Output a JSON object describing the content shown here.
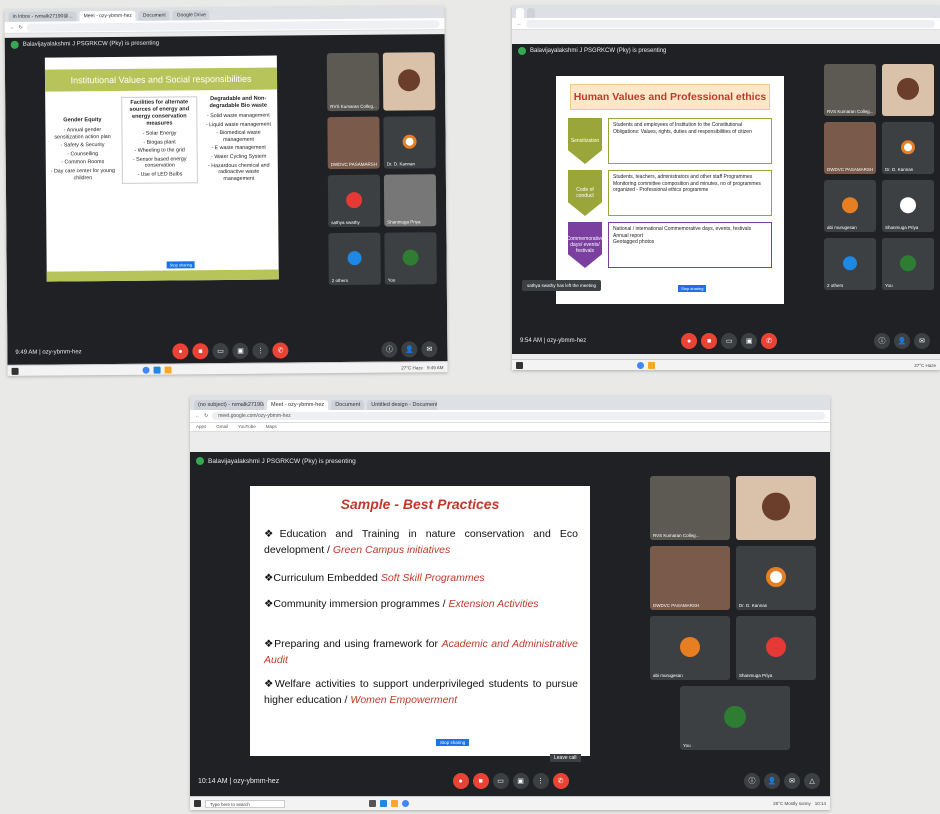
{
  "shot1": {
    "tabs": [
      "In Inbox - rvmalk27190@...",
      "Meet - ozy-ybmm-hez",
      "Document",
      "Google Drive"
    ],
    "presenter": "Balavijayalakshmi J PSGRKCW (Pky) is presenting",
    "slide": {
      "title": "Institutional Values and Social responsibilities",
      "col1_head": "Gender Equity",
      "col1": [
        "- Annual gender sensitization action plan",
        "- Safety & Security",
        "- Counselling",
        "- Common Rooms",
        "- Day care center for young children"
      ],
      "col2_head": "Facilities for alternate sources of energy and energy conservation measures",
      "col2": [
        "- Solar Energy",
        "- Biogas plant",
        "- Wheeling to the grid",
        "- Sensor based energy conservation",
        "- Use of LED Bulbs"
      ],
      "col3_head": "Degradable and Non-degradable Bio waste",
      "col3": [
        "- Solid waste management",
        "- Liquid waste management",
        "- Biomedical waste management",
        "- E waste management",
        "- Water Cycling System",
        "- Hazardous chemical and radioactive waste management"
      ],
      "stop_label": "Stop sharing"
    },
    "participants": [
      "RVS Kumaran Colleg...",
      "",
      "DWDVC PASAMARSH",
      "Dr. D. Kannan",
      "sathya swathy",
      "Shanmuga Priya",
      "2 others",
      "You"
    ],
    "time": "9:49 AM",
    "code": "ozy-ybmm-hez",
    "tray": "27°C Haze",
    "clock": "9:49 AM"
  },
  "shot2": {
    "presenter": "Balavijayalakshmi J PSGRKCW (Pky) is presenting",
    "slide": {
      "title": "Human Values and Professional ethics",
      "row1_label": "Sensitization",
      "row1": [
        "Students and employees of Institution to the Constitutional Obligations: Values, rights, duties and responsibilities of citizen"
      ],
      "row2_label": "Code of conduct",
      "row2": [
        "Students, teachers, administrators and other staff Programmes",
        "Monitoring committee composition and minutes, no of programmes organized - Professional ethics programme"
      ],
      "row3_label": "Commemorative days/ events/ festivals",
      "row3": [
        "National / international Commemorative days, events, festivals",
        "Annual report",
        "Geotagged photos"
      ],
      "stop_label": "Stop sharing"
    },
    "toast": "sathya swathy has left the meeting",
    "participants": [
      "RVS Kumaran Colleg...",
      "",
      "DWDVC PASAMARSH",
      "Dr. D. Kannan",
      "abi murugesan",
      "Shanmuga Priya",
      "2 others",
      "You"
    ],
    "time": "9:54 AM",
    "code": "ozy-ybmm-hez",
    "tray": "27°C Haze"
  },
  "shot3": {
    "tabs": [
      "(no subject) - rvmalk27190@gm...",
      "Meet - ozy-ybmm-hez",
      "Document",
      "Untitled design - Document"
    ],
    "url": "meet.google.com/ozy-ybmm-hez",
    "bookmarks": [
      "Apps",
      "Gmail",
      "YouTube",
      "Maps"
    ],
    "presenter": "Balavijayalakshmi J PSGRKCW (Pky) is presenting",
    "slide": {
      "title": "Sample - Best Practices",
      "items": [
        {
          "text": "Education and Training in nature conservation and Eco development / ",
          "em": "Green Campus initiatives"
        },
        {
          "text": "Curriculum Embedded ",
          "em": "Soft Skill Programmes"
        },
        {
          "text": "Community immersion programmes / ",
          "em": "Extension Activities"
        },
        {
          "text": "Preparing and using framework for ",
          "em": "Academic and Administrative Audit"
        },
        {
          "text": "Welfare activities to support underprivileged students to pursue higher education / ",
          "em": "Women Empowerment"
        }
      ],
      "stop_label": "Stop sharing"
    },
    "participants": [
      "RVS Kumaran Colleg...",
      "",
      "DWDVC PASAMARSH",
      "Dr. D. Kannan",
      "abi murugesan",
      "Shanmuga Priya",
      "You"
    ],
    "leave_label": "Leave call",
    "time": "10:14 AM",
    "code": "ozy-ybmm-hez",
    "search": "Type here to search",
    "tray": "28°C Mostly sunny",
    "clock": "10:14"
  },
  "colors": {
    "meet_bg": "#202124",
    "tile": "#3c4043",
    "end_call": "#ea4335",
    "olive": "#b7c45a",
    "accent_red": "#c0392b"
  }
}
